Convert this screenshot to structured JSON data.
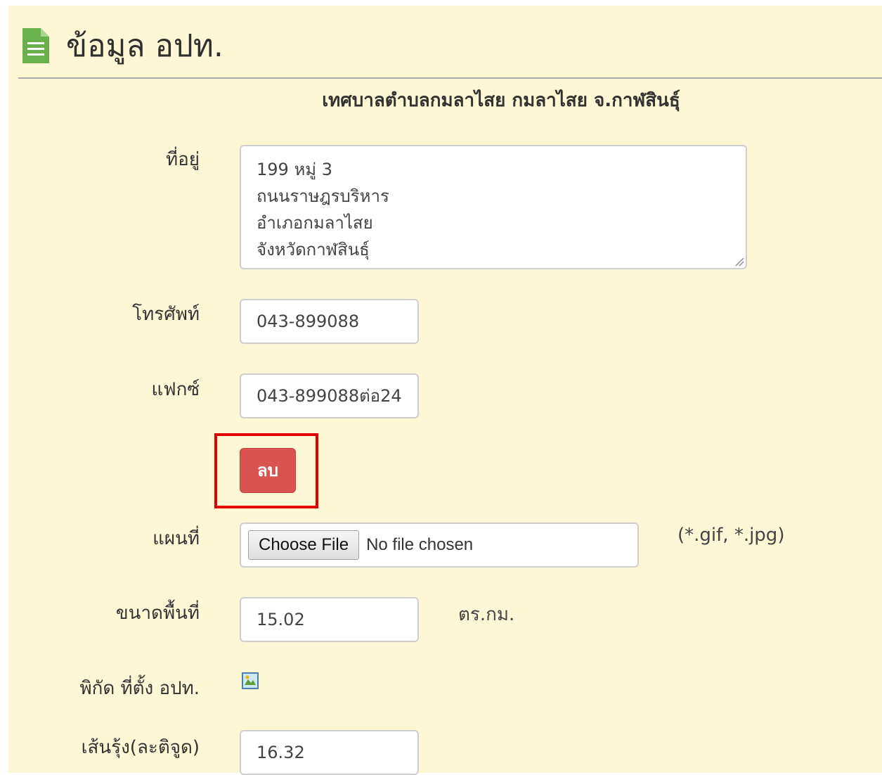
{
  "header": {
    "title": "ข้อมูล อปท.",
    "icon": "document-icon"
  },
  "org_name": "เทศบาลตำบลกมลาไสย กมลาไสย จ.กาฬสินธุ์",
  "address": {
    "label": "ที่อยู่",
    "lines": [
      "199 หมู่ 3",
      "ถนนราษฎรบริหาร",
      "อำเภอกมลาไสย",
      "จังหวัดกาฬสินธุ์"
    ]
  },
  "phone": {
    "label": "โทรศัพท์",
    "value": "043-899088"
  },
  "fax": {
    "label": "แฟกซ์",
    "value": "043-899088ต่อ24"
  },
  "delete_button": {
    "label": "ลบ",
    "color": "#d9534f"
  },
  "map": {
    "label": "แผนที่",
    "choose_label": "Choose File",
    "no_file_label": "No file chosen",
    "hint": "(*.gif, *.jpg)"
  },
  "area": {
    "label": "ขนาดพื้นที่",
    "value": "15.02",
    "unit": "ตร.กม."
  },
  "coordinates": {
    "label": "พิกัด ที่ตั้ง อปท.",
    "icon": "map-icon"
  },
  "latitude": {
    "label": "เส้นรุ้ง(ละติจูด)",
    "value": "16.32"
  },
  "colors": {
    "background": "#fdf7d6",
    "highlight": "#e00000",
    "header_icon": "#6ab04c"
  }
}
